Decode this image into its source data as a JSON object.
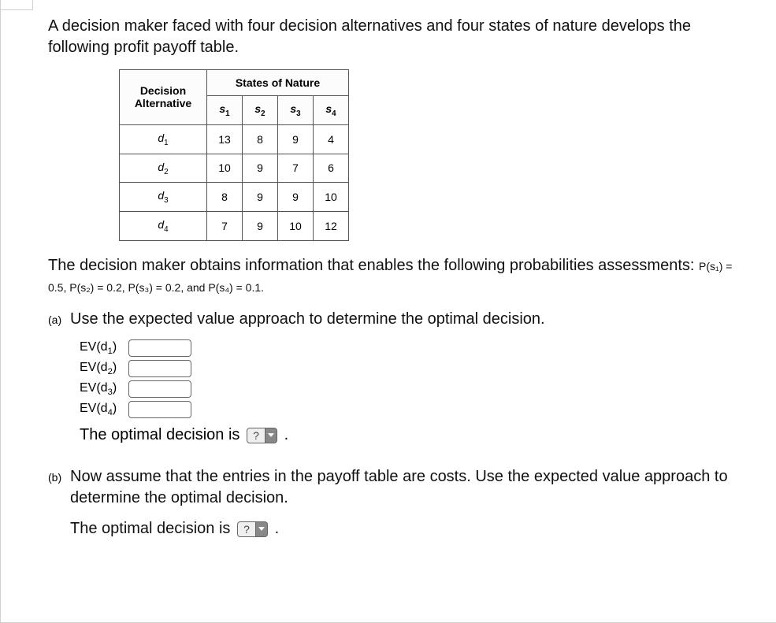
{
  "intro": {
    "p1": "A decision maker faced with four decision alternatives and four states of nature develops the following profit payoff table."
  },
  "table": {
    "decision_header": "Decision Alternative",
    "states_header": "States of Nature",
    "cols": [
      "s",
      "s",
      "s",
      "s"
    ],
    "col_subs": [
      "1",
      "2",
      "3",
      "4"
    ],
    "rows": [
      {
        "label": "d",
        "sub": "1",
        "vals": [
          "13",
          "8",
          "9",
          "4"
        ]
      },
      {
        "label": "d",
        "sub": "2",
        "vals": [
          "10",
          "9",
          "7",
          "6"
        ]
      },
      {
        "label": "d",
        "sub": "3",
        "vals": [
          "8",
          "9",
          "9",
          "10"
        ]
      },
      {
        "label": "d",
        "sub": "4",
        "vals": [
          "7",
          "9",
          "10",
          "12"
        ]
      }
    ]
  },
  "prob_intro": "The decision maker obtains information that enables the following probabilities assessments: ",
  "prob_text": "P(s₁) = 0.5, P(s₂) = 0.2, P(s₃) = 0.2, and P(s₄) = 0.1.",
  "parts": {
    "a": {
      "label": "(a)",
      "prompt": "Use the expected value approach to determine the optimal decision.",
      "ev": [
        {
          "label": "EV(d",
          "sub": "1",
          "close": ")"
        },
        {
          "label": "EV(d",
          "sub": "2",
          "close": ")"
        },
        {
          "label": "EV(d",
          "sub": "3",
          "close": ")"
        },
        {
          "label": "EV(d",
          "sub": "4",
          "close": ")"
        }
      ],
      "optimal": "The optimal decision is",
      "select_placeholder": "?",
      "period": "."
    },
    "b": {
      "label": "(b)",
      "prompt": "Now assume that the entries in the payoff table are costs. Use the expected value approach to determine the optimal decision.",
      "optimal": "The optimal decision is",
      "select_placeholder": "?",
      "period": "."
    }
  },
  "chart_data": {
    "type": "table",
    "title": "Profit payoff table",
    "row_labels": [
      "d1",
      "d2",
      "d3",
      "d4"
    ],
    "col_labels": [
      "s1",
      "s2",
      "s3",
      "s4"
    ],
    "values": [
      [
        13,
        8,
        9,
        4
      ],
      [
        10,
        9,
        7,
        6
      ],
      [
        8,
        9,
        9,
        10
      ],
      [
        7,
        9,
        10,
        12
      ]
    ],
    "probabilities": {
      "s1": 0.5,
      "s2": 0.2,
      "s3": 0.2,
      "s4": 0.1
    }
  }
}
